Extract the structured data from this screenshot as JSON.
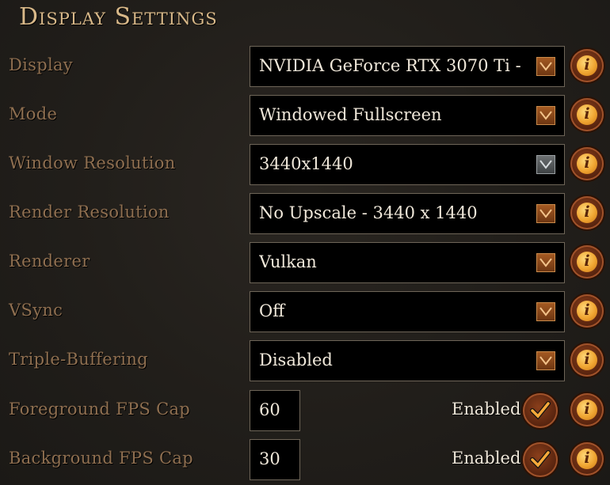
{
  "title": "Display Settings",
  "rows": [
    {
      "label": "Display",
      "value": "NVIDIA GeForce RTX 3070 Ti -",
      "arrow": "orange"
    },
    {
      "label": "Mode",
      "value": "Windowed Fullscreen",
      "arrow": "orange"
    },
    {
      "label": "Window Resolution",
      "value": "3440x1440",
      "arrow": "grey"
    },
    {
      "label": "Render Resolution",
      "value": "No Upscale - 3440 x 1440",
      "arrow": "orange"
    },
    {
      "label": "Renderer",
      "value": "Vulkan",
      "arrow": "orange"
    },
    {
      "label": "VSync",
      "value": "Off",
      "arrow": "orange"
    },
    {
      "label": "Triple-Buffering",
      "value": "Disabled",
      "arrow": "orange"
    }
  ],
  "fps_rows": [
    {
      "label": "Foreground FPS Cap",
      "value": "60",
      "toggle_label": "Enabled",
      "checked": true
    },
    {
      "label": "Background FPS Cap",
      "value": "30",
      "toggle_label": "Enabled",
      "checked": true
    }
  ],
  "info_glyph": "i",
  "icons": {
    "dropdown": "chevron-down-icon",
    "info": "info-icon",
    "check": "checkmark-icon"
  },
  "colors": {
    "accent": "#d9b989",
    "label": "#8f6f50",
    "value": "#f0e8da",
    "arrow": "#a45a22",
    "disabled_arrow": "#6c7072"
  }
}
